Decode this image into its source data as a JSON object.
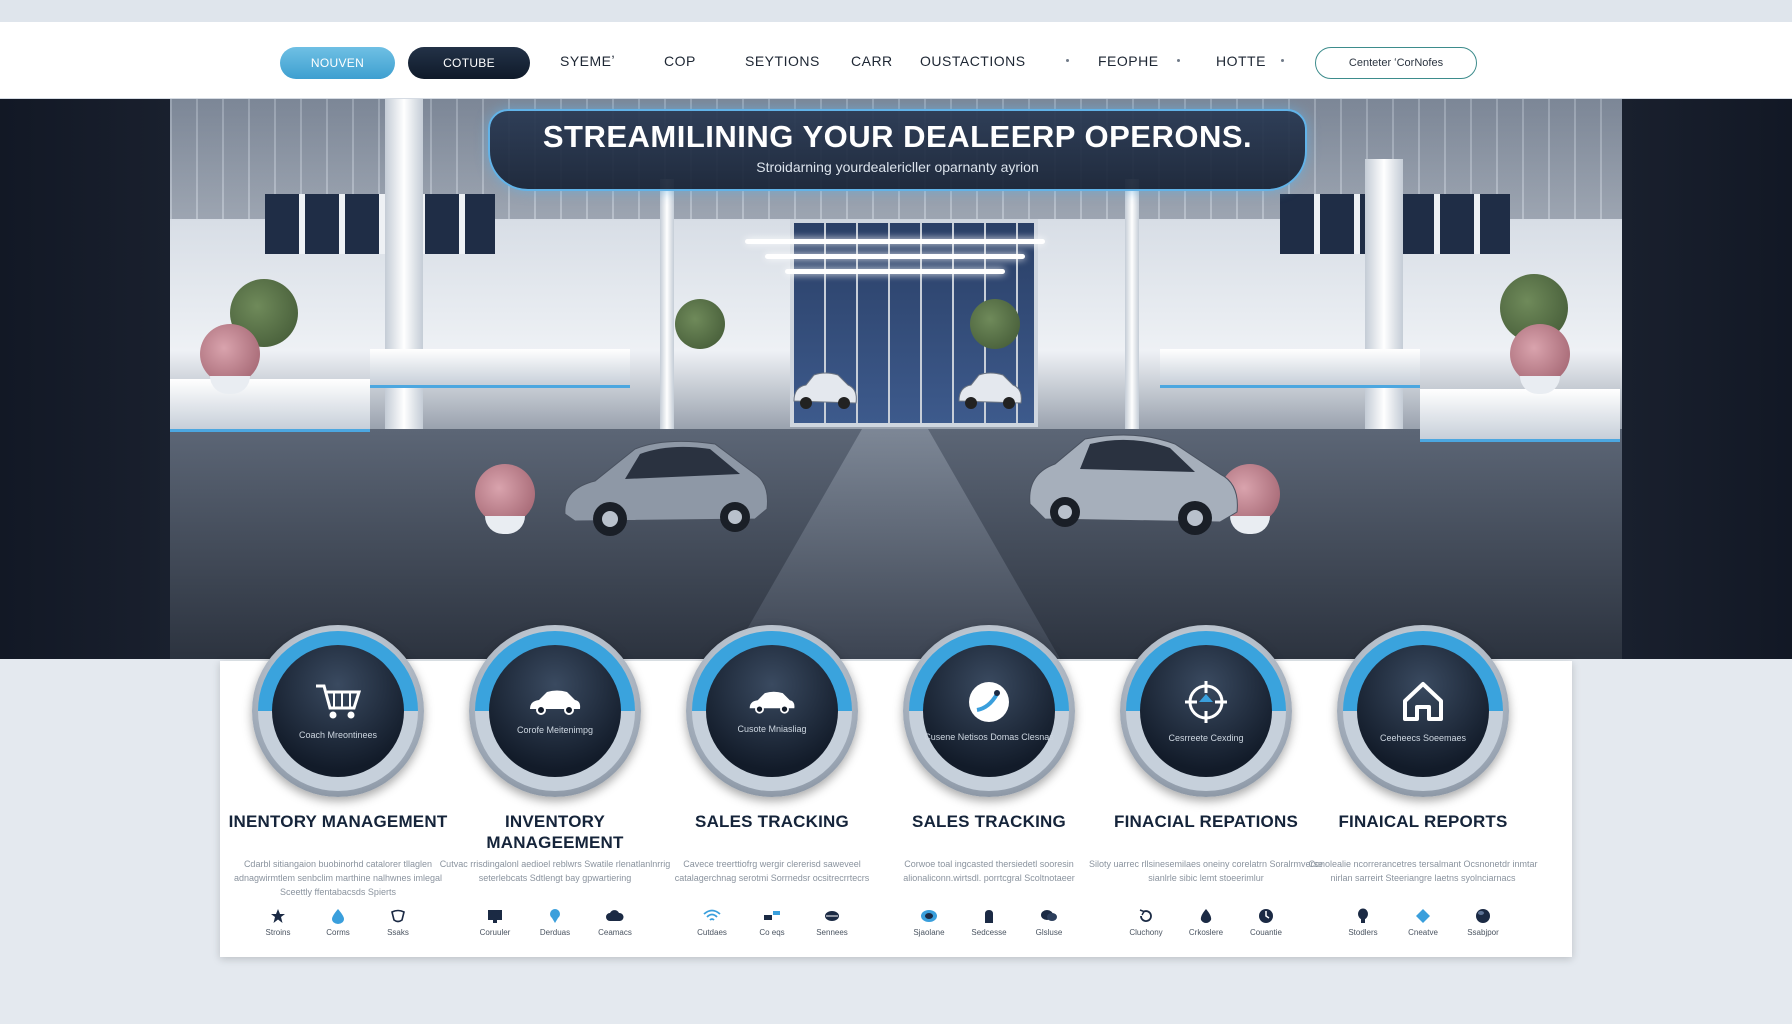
{
  "nav": {
    "pill_1": "NOUVEN",
    "pill_2": "COTUBE",
    "links": [
      "SYEMEʼ",
      "COP",
      "SEYTIONS",
      "CARR",
      "OUSTACTIONS",
      "FEOPHE",
      "HOTTE"
    ],
    "contact": "Centeter ʻCorNofes"
  },
  "hero": {
    "title": "STREAMILINING YOUR DEALEERP OPERONS.",
    "subtitle": "Stroidarning yourdealericller oparnanty ayrion"
  },
  "features": [
    {
      "icon": "shopping-cart-icon",
      "disc_label": "Coach Mreontinees",
      "title": "INENTORY MANAGEMENT",
      "desc": "Cdarbl sitiangaion buobinorhd catalorer tllaglen adnagwirmtlem senbclim marthine nalhwnes imlegal Sceettly ffentabacsds Spierts",
      "minis": [
        {
          "icon": "star-icon",
          "label": "Stroins",
          "color": "#1b2a44"
        },
        {
          "icon": "drop-icon",
          "label": "Corms",
          "color": "#3a9fdc"
        },
        {
          "icon": "shield-icon",
          "label": "Ssaks",
          "color": "#1b2a44"
        }
      ]
    },
    {
      "icon": "car-icon",
      "disc_label": "Corofe Meitenimpg",
      "title": "INVENTORY MANAGEEMENT",
      "desc": "Cutvac rrisdingalonl aedioel reblwrs Swatile rlenatlanlnrrig seterlebcats Sdtlengt bay gpwartiering",
      "minis": [
        {
          "icon": "monitor-icon",
          "label": "Coruuler",
          "color": "#1b2a44"
        },
        {
          "icon": "pin-icon",
          "label": "Derduas",
          "color": "#3a9fdc"
        },
        {
          "icon": "cloud-icon",
          "label": "Ceamacs",
          "color": "#1b2a44"
        }
      ]
    },
    {
      "icon": "car-icon",
      "disc_label": "Cusote Mniasliag",
      "title": "SALES TRACKING",
      "desc": "Cavece treerttiofrg wergir clererisd saweveel catalagerchnag serotmi Sorrnedsr ocsitrecrrtecrs",
      "minis": [
        {
          "icon": "wifi-icon",
          "label": "Cutdaes",
          "color": "#3a9fdc"
        },
        {
          "icon": "cars-icon",
          "label": "Co eqs",
          "color": "#1b2a44"
        },
        {
          "icon": "globe-icon",
          "label": "Sennees",
          "color": "#1b2a44"
        }
      ]
    },
    {
      "icon": "target-globe-icon",
      "disc_label": "Cusene Netisos Domas Clesnas",
      "title": "SALES TRACKING",
      "desc": "Corwoe toal ingcasted thersiedetl sooresin alionaliconn.wirtsdl. porrtcgral Scoltnotaeer",
      "minis": [
        {
          "icon": "coin-icon",
          "label": "Sjaolane",
          "color": "#3a9fdc"
        },
        {
          "icon": "hand-icon",
          "label": "Sedcesse",
          "color": "#1b2a44"
        },
        {
          "icon": "chat-icon",
          "label": "Glsluse",
          "color": "#1b2a44"
        }
      ]
    },
    {
      "icon": "crosshair-icon",
      "disc_label": "Cesrreete Cexding",
      "title": "FINACIAL REPATIONS",
      "desc": "Siloty uarrec rllsinesemilaes oneiny corelatrn Soralrmverse sianlrle sibic lemt stoeerimlur",
      "minis": [
        {
          "icon": "refresh-icon",
          "label": "Cluchony",
          "color": "#1b2a44"
        },
        {
          "icon": "flame-icon",
          "label": "Crkoslere",
          "color": "#1b2a44"
        },
        {
          "icon": "clock-icon",
          "label": "Couantie",
          "color": "#1b2a44"
        }
      ]
    },
    {
      "icon": "home-icon",
      "disc_label": "Ceeheecs Soeemaes",
      "title": "FINAICAL REPORTS",
      "desc": "Conolealie ncorrerancetres tersalmant Ocsnonetdr inmtar nirlan sarreirt Steeriangre laetns syolnciarnacs",
      "minis": [
        {
          "icon": "bulb-icon",
          "label": "Stodlers",
          "color": "#1b2a44"
        },
        {
          "icon": "diamond-icon",
          "label": "Cneatve",
          "color": "#3a9fdc"
        },
        {
          "icon": "sphere-icon",
          "label": "Ssabjpor",
          "color": "#1b2a44"
        }
      ]
    }
  ]
}
